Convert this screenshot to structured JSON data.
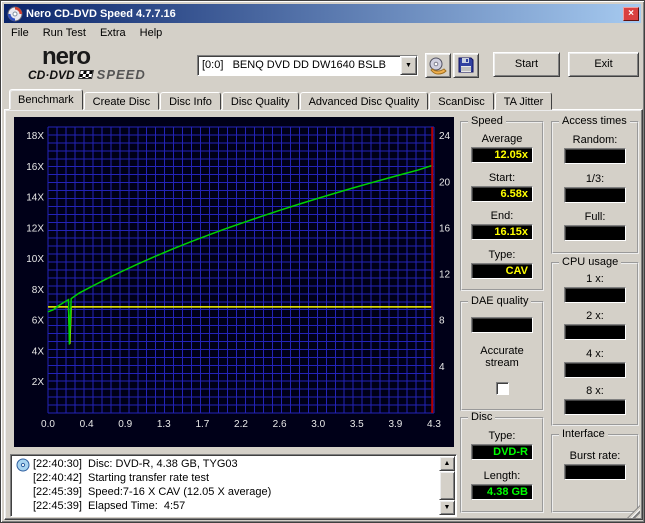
{
  "window": {
    "title": "Nero CD-DVD Speed 4.7.7.16"
  },
  "icons": {
    "close": "×",
    "combo_arrow": "▼",
    "scroll_up": "▲",
    "scroll_down": "▼"
  },
  "menu": {
    "items": [
      "File",
      "Run Test",
      "Extra",
      "Help"
    ]
  },
  "toolbar": {
    "logo": {
      "brand": "nero",
      "sub1": "CD·DVD",
      "sub2": "SPEED"
    },
    "drive_select": {
      "value": "[0:0]   BENQ DVD DD DW1640 BSLB"
    },
    "start_label": "Start",
    "exit_label": "Exit"
  },
  "tabs": {
    "selected": "Benchmark",
    "items": [
      {
        "label": "Benchmark"
      },
      {
        "label": "Create Disc"
      },
      {
        "label": "Disc Info"
      },
      {
        "label": "Disc Quality"
      },
      {
        "label": "Advanced Disc Quality"
      },
      {
        "label": "ScanDisc"
      },
      {
        "label": "TA Jitter"
      }
    ]
  },
  "chart_data": {
    "type": "line",
    "title": "",
    "background": "#000018",
    "axis_text_color": "#e8e8e8",
    "x_axis": {
      "unit": "GB",
      "min": 0,
      "max": 4.33,
      "tick_labels": [
        "0.0",
        "0.4",
        "0.9",
        "1.3",
        "1.7",
        "2.2",
        "2.6",
        "3.0",
        "3.5",
        "3.9",
        "4.3"
      ]
    },
    "y_axis_left": {
      "min": 0,
      "max": 18.6,
      "tick_labels": [
        "2X",
        "4X",
        "6X",
        "8X",
        "10X",
        "12X",
        "14X",
        "16X",
        "18X"
      ],
      "tick_values": [
        2,
        4,
        6,
        8,
        10,
        12,
        14,
        16,
        18
      ]
    },
    "y_axis_right": {
      "min": 0,
      "max": 24.8,
      "tick_labels": [
        "4",
        "8",
        "12",
        "16",
        "20",
        "24"
      ],
      "tick_values": [
        4,
        8,
        12,
        16,
        20,
        24
      ]
    },
    "grid": {
      "color": "#2323b8",
      "cols": 43,
      "rows": 36
    },
    "series": [
      {
        "name": "rotation-speed",
        "color": "#f8f800",
        "axis": "left",
        "points": [
          [
            0,
            6.9
          ],
          [
            0.23,
            6.9
          ],
          [
            0.245,
            4.5
          ],
          [
            0.26,
            6.9
          ],
          [
            4.31,
            6.9
          ]
        ]
      },
      {
        "name": "read-speed",
        "color": "#00d200",
        "axis": "left",
        "points": [
          [
            0,
            6.58
          ],
          [
            0.06,
            6.72
          ],
          [
            0.12,
            6.98
          ],
          [
            0.18,
            7.2
          ],
          [
            0.23,
            7.37
          ],
          [
            0.24,
            4.45
          ],
          [
            0.26,
            7.44
          ],
          [
            0.35,
            7.8
          ],
          [
            0.5,
            8.26
          ],
          [
            0.65,
            8.7
          ],
          [
            0.8,
            9.13
          ],
          [
            1.0,
            9.67
          ],
          [
            1.2,
            10.18
          ],
          [
            1.4,
            10.67
          ],
          [
            1.6,
            11.13
          ],
          [
            1.8,
            11.57
          ],
          [
            2.0,
            12.0
          ],
          [
            2.2,
            12.4
          ],
          [
            2.4,
            12.8
          ],
          [
            2.6,
            13.18
          ],
          [
            2.8,
            13.55
          ],
          [
            3.0,
            13.91
          ],
          [
            3.2,
            14.26
          ],
          [
            3.4,
            14.6
          ],
          [
            3.6,
            14.93
          ],
          [
            3.8,
            15.25
          ],
          [
            4.0,
            15.57
          ],
          [
            4.15,
            15.8
          ],
          [
            4.31,
            16.1
          ]
        ]
      }
    ],
    "end_marker": {
      "x": 4.31,
      "color": "#b40000"
    }
  },
  "panels": {
    "speed": {
      "title": "Speed",
      "average_label": "Average",
      "average_value": "12.05x",
      "start_label": "Start:",
      "start_value": "6.58x",
      "end_label": "End:",
      "end_value": "16.15x",
      "type_label": "Type:",
      "type_value": "CAV"
    },
    "access_times": {
      "title": "Access times",
      "random_label": "Random:",
      "random_value": "",
      "third_label": "1/3:",
      "third_value": "",
      "full_label": "Full:",
      "full_value": ""
    },
    "dae_quality": {
      "title": "DAE quality",
      "value": "",
      "accurate_stream_label": "Accurate stream",
      "accurate_stream_checked": false
    },
    "cpu_usage": {
      "title": "CPU usage",
      "items": [
        {
          "label": "1 x:",
          "value": ""
        },
        {
          "label": "2 x:",
          "value": ""
        },
        {
          "label": "4 x:",
          "value": ""
        },
        {
          "label": "8 x:",
          "value": ""
        }
      ]
    },
    "disc": {
      "title": "Disc",
      "type_label": "Type:",
      "type_value": "DVD-R",
      "length_label": "Length:",
      "length_value": "4.38 GB"
    },
    "interface": {
      "title": "Interface",
      "burst_label": "Burst rate:",
      "burst_value": ""
    }
  },
  "log": {
    "lines": [
      "[22:40:30]  Disc: DVD-R, 4.38 GB, TYG03",
      "[22:40:42]  Starting transfer rate test",
      "[22:45:39]  Speed:7-16 X CAV (12.05 X average)",
      "[22:45:39]  Elapsed Time:  4:57"
    ]
  }
}
